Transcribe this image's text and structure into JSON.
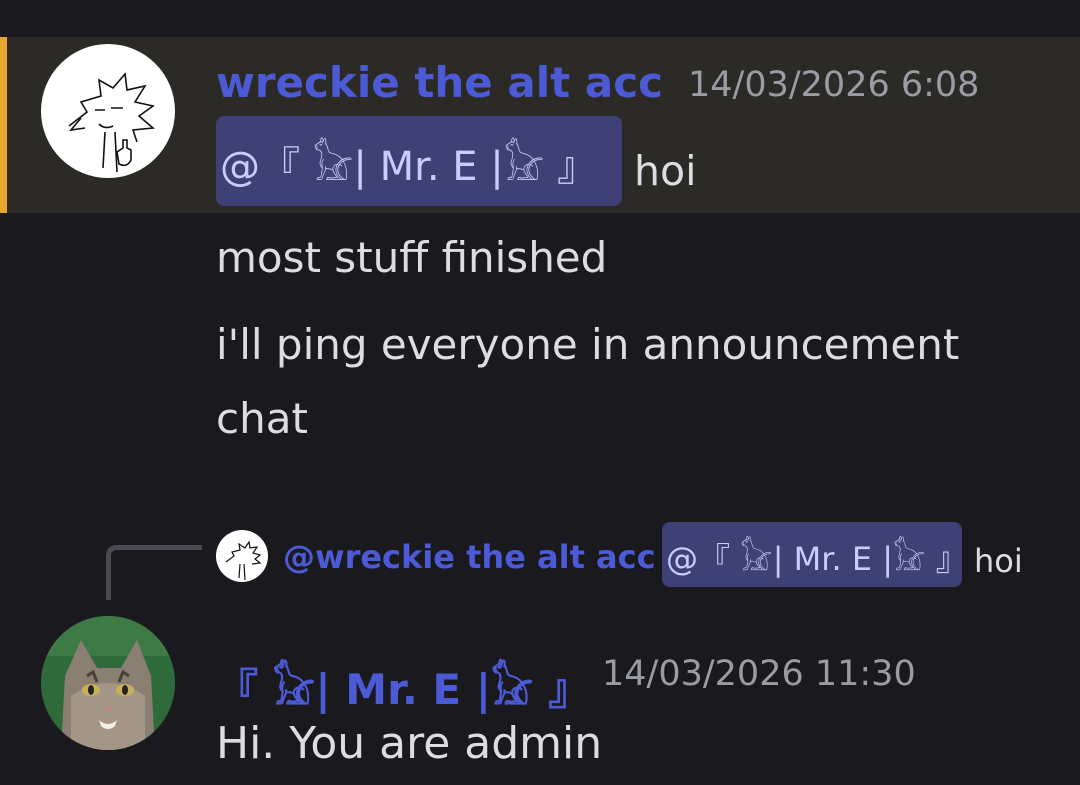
{
  "messages": [
    {
      "author": "wreckie the alt acc",
      "timestamp": "14/03/2026 6:08",
      "mention": "@『 𓃠| Mr. E |𓃠 』",
      "mention_rest": "hoi",
      "lines": [
        "most stuff finished",
        "i'll ping everyone in announcement",
        "chat"
      ],
      "highlight_color": "#e8a830"
    },
    {
      "reply": {
        "author": "@wreckie the alt acc",
        "mention": "@『 𓃠| Mr. E |𓃠 』",
        "rest": "hoi"
      },
      "author": "『 𓃠| Mr. E |𓃠 』",
      "timestamp": "14/03/2026 11:30",
      "lines": [
        "Hi. You are admin"
      ]
    }
  ],
  "colors": {
    "accent": "#4c5ad6",
    "mention_bg": "#3f4176",
    "mention_text": "#c9cdfb"
  }
}
